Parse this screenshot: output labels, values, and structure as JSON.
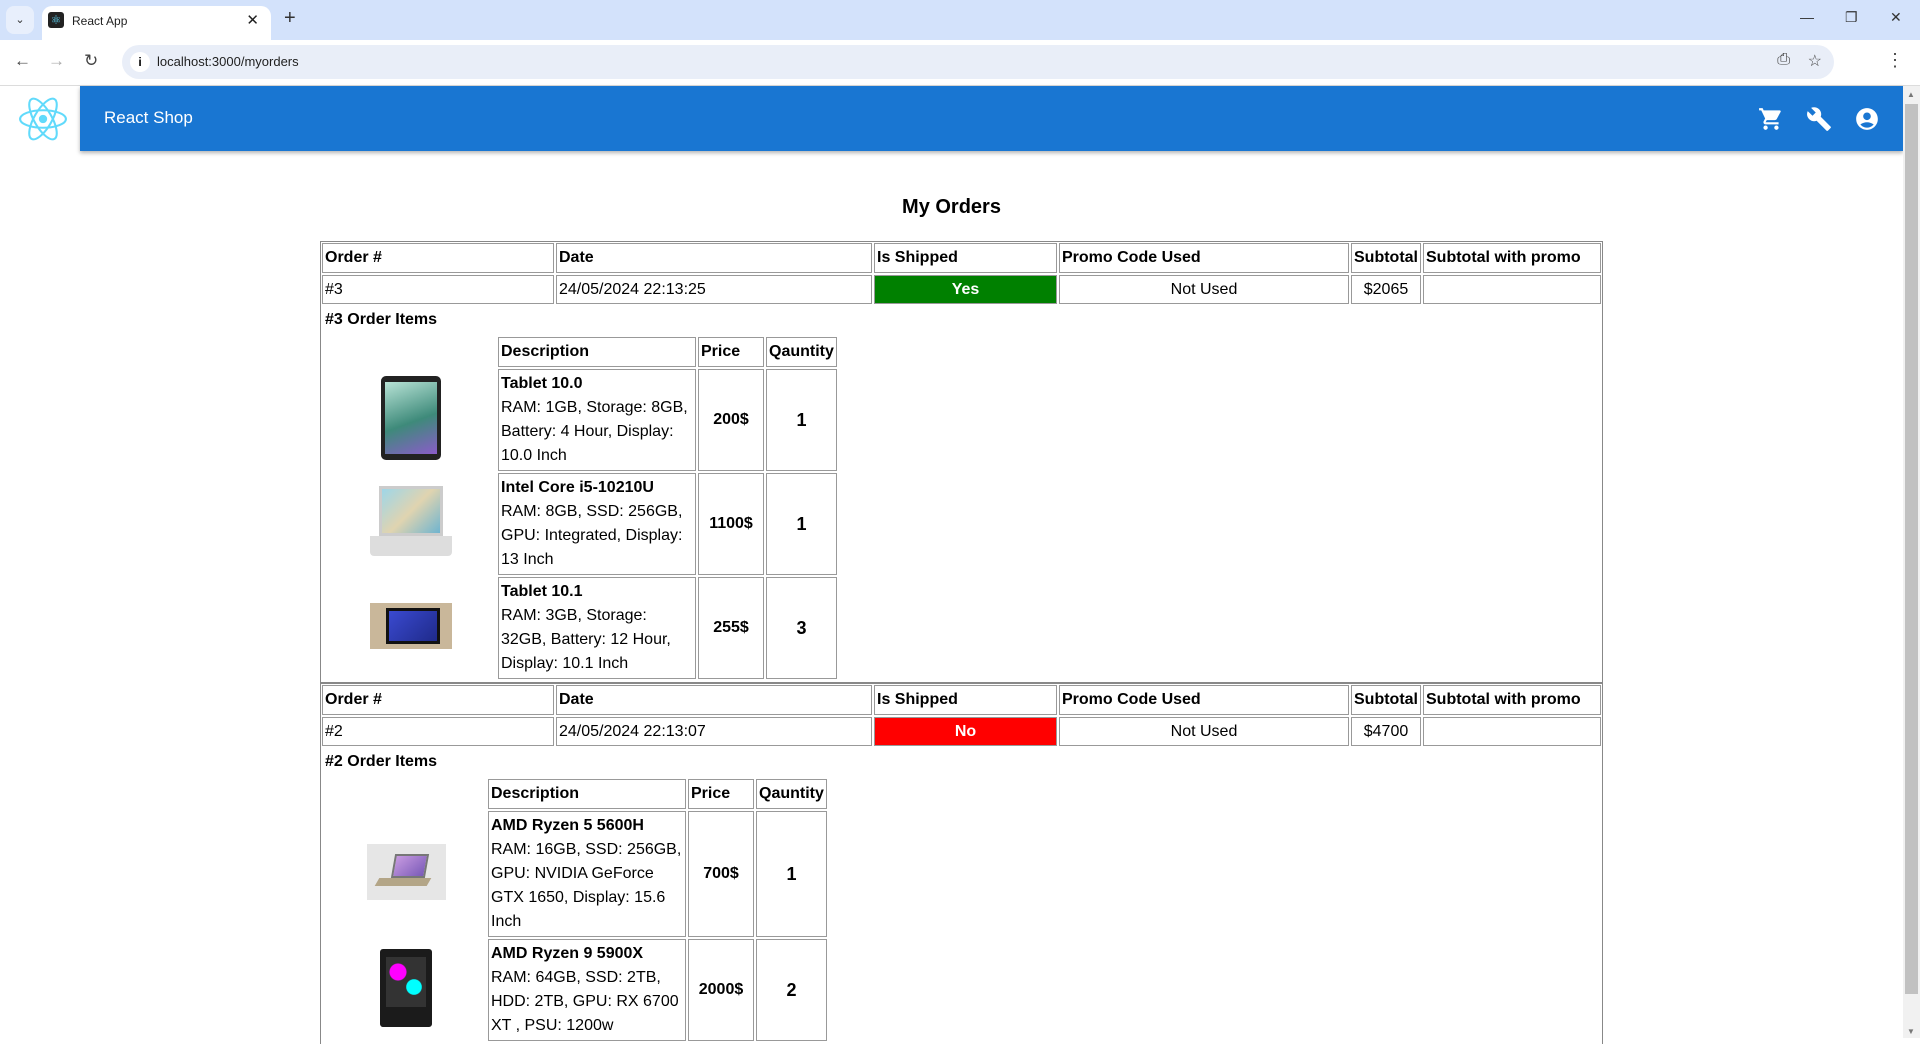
{
  "browser": {
    "tab_title": "React App",
    "url": "localhost:3000/myorders"
  },
  "app": {
    "brand": "React Shop"
  },
  "page": {
    "title": "My Orders"
  },
  "headers": {
    "order": "Order #",
    "date": "Date",
    "shipped": "Is Shipped",
    "promo": "Promo Code Used",
    "subtotal": "Subtotal",
    "subtotal_promo": "Subtotal with promo"
  },
  "item_headers": {
    "description": "Description",
    "price": "Price",
    "quantity": "Qauntity"
  },
  "colors": {
    "shipped_yes": "#008000",
    "shipped_no": "#ff0000",
    "appbar": "#1976d2"
  },
  "orders": [
    {
      "number": "#3",
      "date": "24/05/2024 22:13:25",
      "shipped": "Yes",
      "promo": "Not Used",
      "subtotal": "$2065",
      "subtotal_promo": "",
      "items_title": "#3 Order Items",
      "items": [
        {
          "name": "Tablet 10.0",
          "details": "RAM: 1GB, Storage: 8GB, Battery: 4 Hour, Display: 10.0 Inch",
          "price": "200$",
          "quantity": "1"
        },
        {
          "name": "Intel Core i5-10210U",
          "details": "RAM: 8GB, SSD: 256GB, GPU: Integrated, Display: 13 Inch",
          "price": "1100$",
          "quantity": "1"
        },
        {
          "name": "Tablet 10.1",
          "details": "RAM: 3GB, Storage: 32GB, Battery: 12 Hour, Display: 10.1 Inch",
          "price": "255$",
          "quantity": "3"
        }
      ]
    },
    {
      "number": "#2",
      "date": "24/05/2024 22:13:07",
      "shipped": "No",
      "promo": "Not Used",
      "subtotal": "$4700",
      "subtotal_promo": "",
      "items_title": "#2 Order Items",
      "items": [
        {
          "name": "AMD Ryzen 5 5600H",
          "details": "RAM: 16GB, SSD: 256GB, GPU: NVIDIA GeForce GTX 1650, Display: 15.6 Inch",
          "price": "700$",
          "quantity": "1"
        },
        {
          "name": "AMD Ryzen 9 5900X",
          "details": "RAM: 64GB, SSD: 2TB, HDD: 2TB, GPU: RX 6700 XT , PSU: 1200w",
          "price": "2000$",
          "quantity": "2"
        }
      ]
    }
  ]
}
